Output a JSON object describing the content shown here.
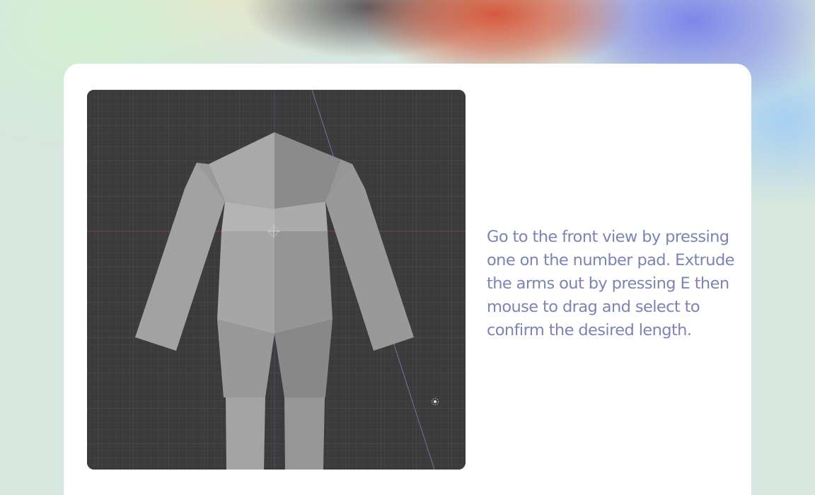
{
  "tutorial_step": {
    "caption": "Go to the front view by pressing one on the number pad. Extrude the arms out by pressing E then mouse to drag and select to confirm the desired length."
  },
  "viewport": {
    "view": "front-orthographic",
    "icons": [
      "3d-cursor-icon",
      "light-object-icon"
    ]
  },
  "colors": {
    "caption_text": "#7d84b5",
    "card_background": "#ffffff",
    "viewport_background": "#3b3b3b"
  }
}
